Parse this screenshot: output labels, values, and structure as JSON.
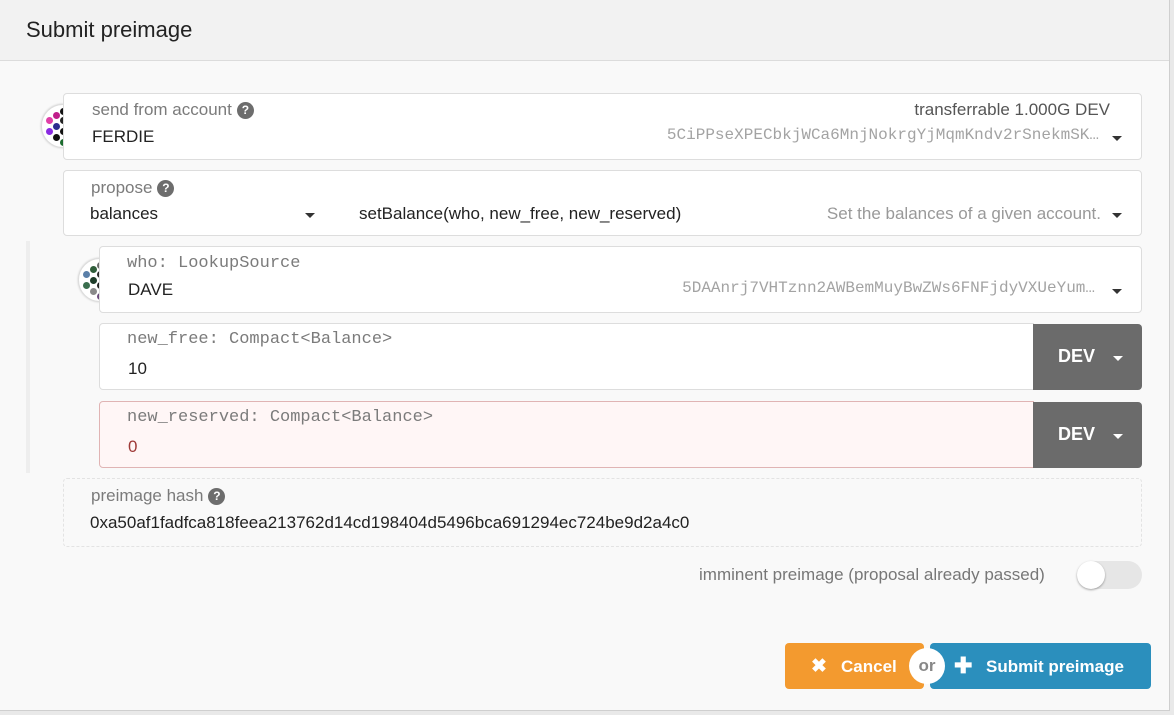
{
  "modal": {
    "title": "Submit preimage"
  },
  "sender": {
    "label": "send from account",
    "name": "FERDIE",
    "address": "5CiPPseXPECbkjWCa6MnjNokrgYjMqmKndv2rSnekmSK…",
    "balance": "transferrable 1.000G DEV"
  },
  "propose": {
    "label": "propose",
    "module": "balances",
    "method": "setBalance(who, new_free, new_reserved)",
    "description": "Set the balances of a given account."
  },
  "params": {
    "who": {
      "label": "who: LookupSource",
      "name": "DAVE",
      "address": "5DAAnrj7VHTznn2AWBemMuyBwZWs6FNFjdyVXUeYum…"
    },
    "new_free": {
      "label": "new_free: Compact<Balance>",
      "value": "10",
      "unit": "DEV"
    },
    "new_reserved": {
      "label": "new_reserved: Compact<Balance>",
      "value": "0",
      "unit": "DEV"
    }
  },
  "preimage": {
    "label": "preimage hash",
    "hash": "0xa50af1fadfca818feea213762d14cd198404d5496bca691294ec724be9d2a4c0"
  },
  "imminent": {
    "label": "imminent preimage (proposal already passed)",
    "enabled": false
  },
  "actions": {
    "cancel": "Cancel",
    "or": "or",
    "submit": "Submit preimage"
  },
  "colors": {
    "cancel": "#f39a2f",
    "submit": "#2b8fbd",
    "error_bg": "#fff6f6",
    "unit_bg": "#6b6b6b"
  }
}
